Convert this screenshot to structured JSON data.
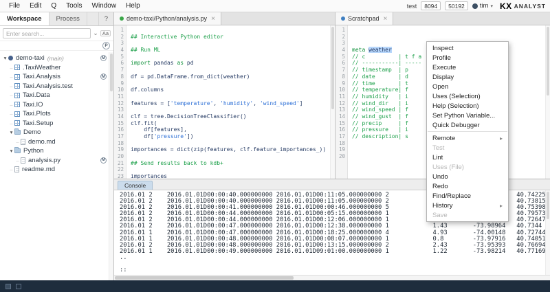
{
  "menubar": {
    "items": [
      "File",
      "Edit",
      "Q",
      "Tools",
      "Window",
      "Help"
    ],
    "server": "test",
    "port1": "8094",
    "port2": "50192",
    "user": "tim",
    "logo_kx": "KX",
    "logo_name": "ANALYST"
  },
  "sidebar": {
    "tabs": [
      "Workspace",
      "Process",
      "?"
    ],
    "search_placeholder": "Enter search...",
    "filter_icon": "Aa",
    "process_badge": "P",
    "tree": [
      {
        "indent": 0,
        "exp": "open",
        "icon": "project",
        "label": "demo-taxi",
        "suffix": "(main)",
        "badge": "M"
      },
      {
        "indent": 1,
        "icon": "grid",
        "label": ".TaxiWeather"
      },
      {
        "indent": 1,
        "icon": "grid",
        "label": "Taxi.Analysis",
        "badge": "M"
      },
      {
        "indent": 1,
        "icon": "grid",
        "label": "Taxi.Analysis.test"
      },
      {
        "indent": 1,
        "icon": "grid",
        "label": "Taxi.Data"
      },
      {
        "indent": 1,
        "icon": "grid",
        "label": "Taxi.IO"
      },
      {
        "indent": 1,
        "icon": "grid",
        "label": "Taxi.Plots"
      },
      {
        "indent": 1,
        "icon": "grid",
        "label": "Taxi.Setup"
      },
      {
        "indent": 1,
        "exp": "open",
        "icon": "folder",
        "label": "Demo"
      },
      {
        "indent": 2,
        "icon": "file",
        "label": "demo.md"
      },
      {
        "indent": 1,
        "exp": "open",
        "icon": "folder",
        "label": "Python"
      },
      {
        "indent": 2,
        "icon": "file",
        "label": "analysis.py",
        "badge": "M"
      },
      {
        "indent": 1,
        "icon": "file",
        "label": "readme.md"
      }
    ]
  },
  "python_editor": {
    "tab_label": "demo-taxi/Python/analysis.py",
    "close": "×",
    "lines": [
      [],
      [
        [
          "com",
          "## Interactive Python editor"
        ]
      ],
      [],
      [
        [
          "com",
          "## Run ML"
        ]
      ],
      [],
      [
        [
          "kw",
          "import"
        ],
        [
          "pl",
          " pandas "
        ],
        [
          "kw",
          "as"
        ],
        [
          "pl",
          " pd"
        ]
      ],
      [],
      [
        [
          "pl",
          "df = pd.DataFrame.from_dict(weather)"
        ]
      ],
      [],
      [
        [
          "pl",
          "df.columns"
        ]
      ],
      [],
      [
        [
          "pl",
          "features = ["
        ],
        [
          "str",
          "'temperature'"
        ],
        [
          "pl",
          ", "
        ],
        [
          "str",
          "'humidity'"
        ],
        [
          "pl",
          ", "
        ],
        [
          "str",
          "'wind_speed'"
        ],
        [
          "pl",
          "]"
        ]
      ],
      [],
      [
        [
          "pl",
          "clf = tree.DecisionTreeClassifier()"
        ]
      ],
      [
        [
          "pl",
          "clf.fit("
        ]
      ],
      [
        [
          "pl",
          "    df[features],"
        ]
      ],
      [
        [
          "pl",
          "    df["
        ],
        [
          "str",
          "'pressure'"
        ],
        [
          "pl",
          "])"
        ]
      ],
      [],
      [
        [
          "pl",
          "importances = dict(zip(features, clf.feature_importances_))"
        ]
      ],
      [],
      [
        [
          "com",
          "## Send results back to kdb+"
        ]
      ],
      [],
      [
        [
          "pl",
          "importances"
        ]
      ]
    ]
  },
  "scratchpad": {
    "tab_label": "Scratchpad",
    "close": "×",
    "lines": [
      [],
      [],
      [],
      [
        [
          "kw",
          "meta"
        ],
        [
          "pl",
          " "
        ],
        [
          "sel",
          "weather"
        ]
      ],
      [
        [
          "com",
          "// c          | t f a"
        ]
      ],
      [
        [
          "com",
          "// -----------| -----"
        ]
      ],
      [
        [
          "com",
          "// timestamp  | p"
        ]
      ],
      [
        [
          "com",
          "// date       | d"
        ]
      ],
      [
        [
          "com",
          "// time       | t"
        ]
      ],
      [
        [
          "com",
          "// temperature| f"
        ]
      ],
      [
        [
          "com",
          "// humidity   | i"
        ]
      ],
      [
        [
          "com",
          "// wind_dir   | i"
        ]
      ],
      [
        [
          "com",
          "// wind_speed | f"
        ]
      ],
      [
        [
          "com",
          "// wind_gust  | f"
        ]
      ],
      [
        [
          "com",
          "// precip     | f"
        ]
      ],
      [
        [
          "com",
          "// pressure   | i"
        ]
      ],
      [
        [
          "com",
          "// description| s"
        ]
      ],
      [],
      [],
      []
    ]
  },
  "context_menu": {
    "items": [
      {
        "label": "Inspect"
      },
      {
        "label": "Profile"
      },
      {
        "label": "Execute"
      },
      {
        "label": "Display"
      },
      {
        "label": "Open"
      },
      {
        "label": "Uses (Selection)"
      },
      {
        "label": "Help (Selection)"
      },
      {
        "label": "Set Python Variable..."
      },
      {
        "label": "Quick Debugger"
      },
      {
        "sep": true
      },
      {
        "label": "Remote",
        "submenu": true
      },
      {
        "label": "Test",
        "disabled": true
      },
      {
        "label": "Lint"
      },
      {
        "label": "Uses (File)",
        "disabled": true
      },
      {
        "label": "Undo"
      },
      {
        "label": "Redo"
      },
      {
        "label": "Find/Replace"
      },
      {
        "label": "History",
        "submenu": true
      },
      {
        "label": "Save",
        "disabled": true
      }
    ]
  },
  "console": {
    "tab_label": "Console",
    "lines": [
      "2016.01 2    2016.01.01D00:00:40.000000000 2016.01.01D00:11:05.000000000 2            1.3                    40.74225",
      "2016.01 2    2016.01.01D00:00:40.000000000 2016.01.01D00:11:05.000000000 2            1.03                   40.73815",
      "2016.01 2    2016.01.01D00:00:41.000000000 2016.01.01D00:00:46.000000000 5            0                      40.75398",
      "2016.01 2    2016.01.01D00:00:44.000000000 2016.01.01D00:05:15.000000000 1            1.1                    40.79573",
      "2016.01 2    2016.01.01D00:00:44.000000000 2016.01.01D00:12:06.000000000 1            1.85                   40.72647",
      "2016.01 2    2016.01.01D00:00:47.000000000 2016.01.01D00:12:38.000000000 1            1.43       -73.98964   40.7344",
      "2016.01 1    2016.01.01D00:00:47.000000000 2016.01.01D00:18:25.000000000 4            4.93       -74.00148   40.72744",
      "2016.01 1    2016.01.01D00:00:48.000000000 2016.01.01D00:08:07.000000000 1            0.8        -73.97916   40.74051",
      "2016.01 2    2016.01.01D00:00:48.000000000 2016.01.01D00:13:15.000000000 2            2.43       -73.95393   40.76694",
      "2016.01 1    2016.01.01D00:00:49.000000000 2016.01.01D09:01:00.000000000 1            1.22       -73.98214   40.77169",
      "..",
      "",
      "::"
    ]
  }
}
